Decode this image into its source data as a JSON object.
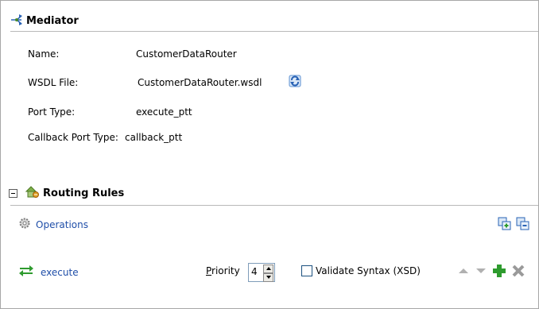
{
  "mediator": {
    "title": "Mediator",
    "fields": [
      {
        "label": "Name:",
        "value": "CustomerDataRouter"
      },
      {
        "label": "WSDL File:",
        "value": "CustomerDataRouter.wsdl"
      },
      {
        "label": "Port Type:",
        "value": "execute_ptt"
      },
      {
        "label": "Callback Port Type:",
        "value": "callback_ptt"
      }
    ]
  },
  "routing_rules": {
    "title": "Routing Rules",
    "operations_label": "Operations",
    "operation": {
      "name": "execute",
      "priority_label_prefix": "P",
      "priority_label_rest": "riority",
      "priority_value": "4",
      "validate_label": "Validate Syntax (XSD)",
      "validate_checked": false
    }
  },
  "icons": {
    "mediator": "mediator-icon",
    "refresh": "refresh-wsdl-icon",
    "routing": "routing-rules-icon",
    "operations": "gear-icon",
    "expand_all": "expand-all-icon",
    "collapse_all": "collapse-all-icon",
    "operation": "operation-arrows-icon",
    "move_up": "arrow-up-icon",
    "move_down": "arrow-down-icon",
    "add": "add-icon",
    "delete": "delete-icon"
  },
  "colors": {
    "link": "#1f4ea8",
    "add_green": "#2e9b2e",
    "separator": "#b9b9b9"
  }
}
